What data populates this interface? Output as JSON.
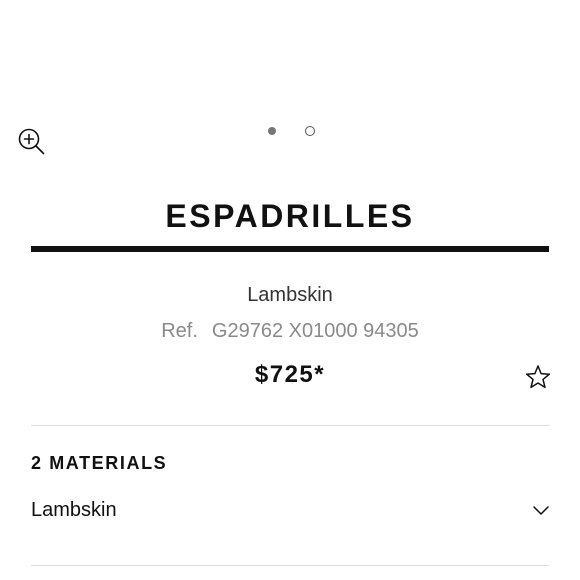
{
  "gallery": {
    "zoom_icon": "zoom-in-icon",
    "slides_total": 2,
    "active_slide": 1
  },
  "product": {
    "title": "ESPADRILLES",
    "material": "Lambskin",
    "ref_label": "Ref.",
    "ref_code": "G29762 X01000 94305",
    "price": "$725*",
    "wishlist_icon": "star-icon"
  },
  "materials": {
    "heading": "2 MATERIALS",
    "selected": "Lambskin",
    "expand_icon": "chevron-down-icon"
  },
  "colors": {
    "text": "#111111",
    "muted": "#8a8a8a",
    "divider": "#dddddd"
  }
}
